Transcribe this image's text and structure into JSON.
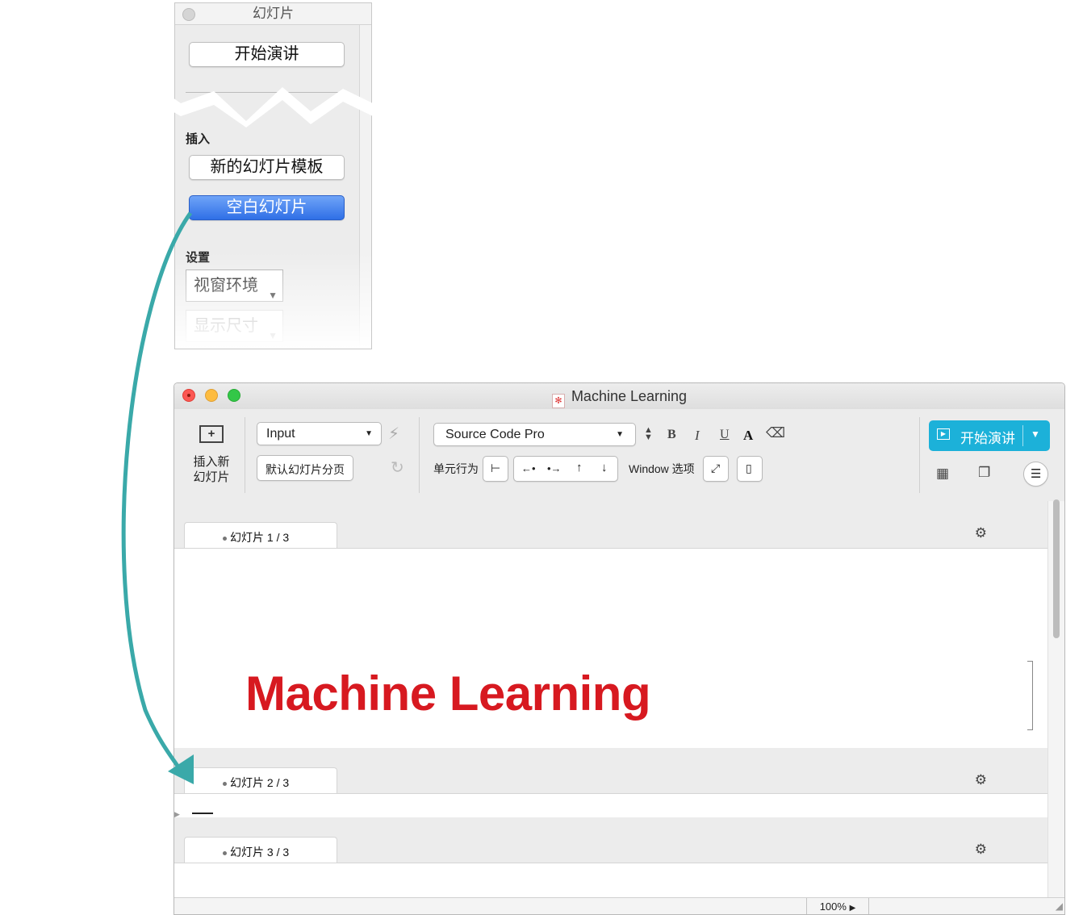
{
  "palette": {
    "title": "幻灯片",
    "start_button": "开始演讲",
    "insert_label": "插入",
    "new_template_button": "新的幻灯片模板",
    "blank_slide_button": "空白幻灯片",
    "settings_label": "设置",
    "environment_select": "视窗环境",
    "display_size_select": "显示尺寸"
  },
  "window": {
    "title": "Machine Learning",
    "insert_new_slide": [
      "插入新",
      "幻灯片"
    ],
    "style_select": "Input",
    "default_pagebreak_button": "默认幻灯片分页",
    "font_select": "Source Code Pro",
    "format": {
      "bold": "B",
      "italic": "I",
      "underline": "U",
      "color": "A"
    },
    "cell_behavior_label": "单元行为",
    "window_options_label": "Window 选项",
    "present_button": "开始演讲",
    "slides": [
      {
        "tab": "幻灯片  1  /  3",
        "heading": "Machine Learning"
      },
      {
        "tab": "幻灯片  2  /  3"
      },
      {
        "tab": "幻灯片  3  /  3"
      }
    ],
    "zoom": "100%"
  },
  "colors": {
    "heading": "#d71920",
    "present_button": "#1cb1d9",
    "arrow": "#3aa9a9",
    "blank_slide_button": "#3a78ee"
  }
}
